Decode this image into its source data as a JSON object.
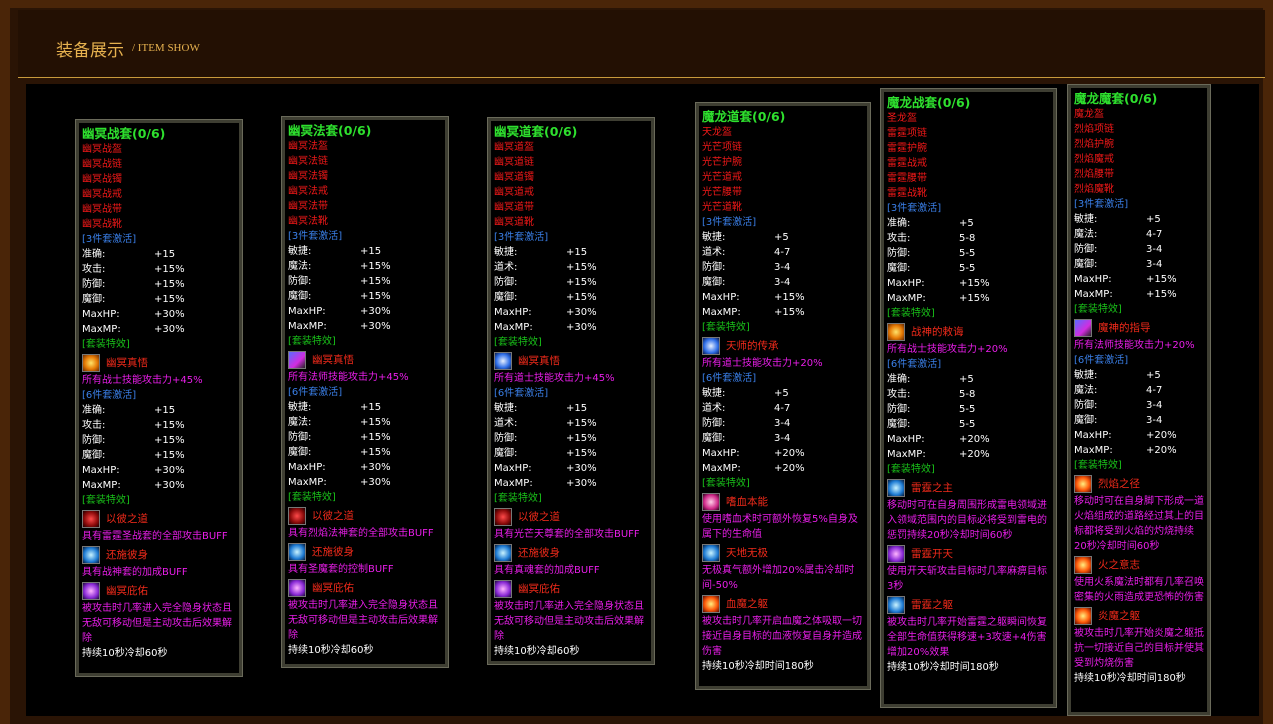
{
  "header": {
    "title_cn": "装备展示",
    "title_en": "/ ITEM SHOW"
  },
  "sets": [
    {
      "name": "幽冥战套(0/6)",
      "pieces": [
        "幽冥战盔",
        "幽冥战链",
        "幽冥战镯",
        "幽冥战戒",
        "幽冥战带",
        "幽冥战靴"
      ],
      "set3_label": "[3件套激活]",
      "set3_stats": [
        [
          "准确:",
          "+15"
        ],
        [
          "攻击:",
          "+15%"
        ],
        [
          "防御:",
          "+15%"
        ],
        [
          "魔御:",
          "+15%"
        ],
        [
          "MaxHP:",
          "+30%"
        ],
        [
          "MaxMP:",
          "+30%"
        ]
      ],
      "effect_label": "[套装特效]",
      "skill3": {
        "icon": "warrior-skill-icon",
        "name": "幽冥真悟",
        "desc": "所有战士技能攻击力+45%"
      },
      "set6_label": "[6件套激活]",
      "set6_stats": [
        [
          "准确:",
          "+15"
        ],
        [
          "攻击:",
          "+15%"
        ],
        [
          "防御:",
          "+15%"
        ],
        [
          "魔御:",
          "+15%"
        ],
        [
          "MaxHP:",
          "+30%"
        ],
        [
          "MaxMP:",
          "+30%"
        ]
      ],
      "effect6_label": "[套装特效]",
      "skills6": [
        {
          "icon": "dark-skill-icon",
          "name": "以彼之道",
          "desc": "具有雷霆圣战套的全部攻击BUFF"
        },
        {
          "icon": "blue-skill-icon",
          "name": "还施彼身",
          "desc": "具有战神套的加成BUFF"
        },
        {
          "icon": "purple-skill-icon",
          "name": "幽冥庇佑",
          "desc": "被攻击时几率进入完全隐身状态且无敌可移动但是主动攻击后效果解除"
        }
      ],
      "duration": "持续10秒冷却60秒"
    },
    {
      "name": "幽冥法套(0/6)",
      "pieces": [
        "幽冥法盔",
        "幽冥法链",
        "幽冥法镯",
        "幽冥法戒",
        "幽冥法带",
        "幽冥法靴"
      ],
      "set3_label": "[3件套激活]",
      "set3_stats": [
        [
          "敏捷:",
          "+15"
        ],
        [
          "魔法:",
          "+15%"
        ],
        [
          "防御:",
          "+15%"
        ],
        [
          "魔御:",
          "+15%"
        ],
        [
          "MaxHP:",
          "+30%"
        ],
        [
          "MaxMP:",
          "+30%"
        ]
      ],
      "effect_label": "[套装特效]",
      "skill3": {
        "icon": "mage-skill-icon",
        "name": "幽冥真悟",
        "desc": "所有法师技能攻击力+45%"
      },
      "set6_label": "[6件套激活]",
      "set6_stats": [
        [
          "敏捷:",
          "+15"
        ],
        [
          "魔法:",
          "+15%"
        ],
        [
          "防御:",
          "+15%"
        ],
        [
          "魔御:",
          "+15%"
        ],
        [
          "MaxHP:",
          "+30%"
        ],
        [
          "MaxMP:",
          "+30%"
        ]
      ],
      "effect6_label": "[套装特效]",
      "skills6": [
        {
          "icon": "dark-skill-icon",
          "name": "以彼之道",
          "desc": "具有烈焰法神套的全部攻击BUFF"
        },
        {
          "icon": "blue-skill-icon",
          "name": "还施彼身",
          "desc": "具有圣魔套的控制BUFF"
        },
        {
          "icon": "purple-skill-icon",
          "name": "幽冥庇佑",
          "desc": "被攻击时几率进入完全隐身状态且无敌可移动但是主动攻击后效果解除"
        }
      ],
      "duration": "持续10秒冷却60秒"
    },
    {
      "name": "幽冥道套(0/6)",
      "pieces": [
        "幽冥道盔",
        "幽冥道链",
        "幽冥道镯",
        "幽冥道戒",
        "幽冥道带",
        "幽冥道靴"
      ],
      "set3_label": "[3件套激活]",
      "set3_stats": [
        [
          "敏捷:",
          "+15"
        ],
        [
          "道术:",
          "+15%"
        ],
        [
          "防御:",
          "+15%"
        ],
        [
          "魔御:",
          "+15%"
        ],
        [
          "MaxHP:",
          "+30%"
        ],
        [
          "MaxMP:",
          "+30%"
        ]
      ],
      "effect_label": "[套装特效]",
      "skill3": {
        "icon": "taoist-skill-icon",
        "name": "幽冥真悟",
        "desc": "所有道士技能攻击力+45%"
      },
      "set6_label": "[6件套激活]",
      "set6_stats": [
        [
          "敏捷:",
          "+15"
        ],
        [
          "道术:",
          "+15%"
        ],
        [
          "防御:",
          "+15%"
        ],
        [
          "魔御:",
          "+15%"
        ],
        [
          "MaxHP:",
          "+30%"
        ],
        [
          "MaxMP:",
          "+30%"
        ]
      ],
      "effect6_label": "[套装特效]",
      "skills6": [
        {
          "icon": "dark-skill-icon",
          "name": "以彼之道",
          "desc": "具有光芒天尊套的全部攻击BUFF"
        },
        {
          "icon": "blue-skill-icon",
          "name": "还施彼身",
          "desc": "具有真魂套的加成BUFF"
        },
        {
          "icon": "purple-skill-icon",
          "name": "幽冥庇佑",
          "desc": "被攻击时几率进入完全隐身状态且无敌可移动但是主动攻击后效果解除"
        }
      ],
      "duration": "持续10秒冷却60秒"
    },
    {
      "name": "魔龙道套(0/6)",
      "pieces": [
        "天龙盔",
        "光芒项链",
        "光芒护腕",
        "光芒道戒",
        "光芒腰带",
        "光芒道靴"
      ],
      "set3_label": "[3件套激活]",
      "set3_stats": [
        [
          "敏捷:",
          "+5"
        ],
        [
          "道术:",
          "4-7"
        ],
        [
          "防御:",
          "3-4"
        ],
        [
          "魔御:",
          "3-4"
        ],
        [
          "MaxHP:",
          "+15%"
        ],
        [
          "MaxMP:",
          "+15%"
        ]
      ],
      "effect_label": "[套装特效]",
      "skill3": {
        "icon": "taoist-skill-icon",
        "name": "天师的传承",
        "desc": "所有道士技能攻击力+20%"
      },
      "set6_label": "[6件套激活]",
      "set6_stats": [
        [
          "敏捷:",
          "+5"
        ],
        [
          "道术:",
          "4-7"
        ],
        [
          "防御:",
          "3-4"
        ],
        [
          "魔御:",
          "3-4"
        ],
        [
          "MaxHP:",
          "+20%"
        ],
        [
          "MaxMP:",
          "+20%"
        ]
      ],
      "effect6_label": "[套装特效]",
      "skills6": [
        {
          "icon": "pink-skill-icon",
          "name": "嗜血本能",
          "desc": "使用嗜血术时可额外恢复5%自身及属下的生命值"
        },
        {
          "icon": "blue-skill-icon",
          "name": "天地无极",
          "desc": "无极真气额外增加20%属击冷却时间-50%"
        },
        {
          "icon": "fire-skill-icon",
          "name": "血魔之躯",
          "desc": "被攻击时几率开启血魔之体吸取一切接近自身目标的血液恢复自身并造成伤害"
        }
      ],
      "duration": "持续10秒冷却时间180秒"
    },
    {
      "name": "魔龙战套(0/6)",
      "pieces": [
        "圣龙盔",
        "雷霆项链",
        "雷霆护腕",
        "雷霆战戒",
        "雷霆腰带",
        "雷霆战靴"
      ],
      "set3_label": "[3件套激活]",
      "set3_stats": [
        [
          "准确:",
          "+5"
        ],
        [
          "攻击:",
          "5-8"
        ],
        [
          "防御:",
          "5-5"
        ],
        [
          "魔御:",
          "5-5"
        ],
        [
          "MaxHP:",
          "+15%"
        ],
        [
          "MaxMP:",
          "+15%"
        ]
      ],
      "effect_label": "[套装特效]",
      "skill3": {
        "icon": "warrior-skill-icon",
        "name": "战神的敕诲",
        "desc": "所有战士技能攻击力+20%"
      },
      "set6_label": "[6件套激活]",
      "set6_stats": [
        [
          "准确:",
          "+5"
        ],
        [
          "攻击:",
          "5-8"
        ],
        [
          "防御:",
          "5-5"
        ],
        [
          "魔御:",
          "5-5"
        ],
        [
          "MaxHP:",
          "+20%"
        ],
        [
          "MaxMP:",
          "+20%"
        ]
      ],
      "effect6_label": "[套装特效]",
      "skills6": [
        {
          "icon": "blue-skill-icon",
          "name": "雷霆之主",
          "desc": "移动时可在自身周围形成雷电领域进入领域范围内的目标必将受到雷电的惩罚持续20秒冷却时间60秒"
        },
        {
          "icon": "purple-skill-icon",
          "name": "雷霆开天",
          "desc": "使用开天斩攻击目标时几率麻痹目标3秒"
        },
        {
          "icon": "blue-skill-icon",
          "name": "雷霆之躯",
          "desc": "被攻击时几率开始雷霆之躯瞬间恢复全部生命值获得移速+3攻速+4伤害增加20%效果"
        }
      ],
      "duration": "持续10秒冷却时间180秒"
    },
    {
      "name": "魔龙魔套(0/6)",
      "pieces": [
        "魔龙盔",
        "烈焰项链",
        "烈焰护腕",
        "烈焰魔戒",
        "烈焰腰带",
        "烈焰魔靴"
      ],
      "set3_label": "[3件套激活]",
      "set3_stats": [
        [
          "敏捷:",
          "+5"
        ],
        [
          "魔法:",
          "4-7"
        ],
        [
          "防御:",
          "3-4"
        ],
        [
          "魔御:",
          "3-4"
        ],
        [
          "MaxHP:",
          "+15%"
        ],
        [
          "MaxMP:",
          "+15%"
        ]
      ],
      "effect_label": "[套装特效]",
      "skill3": {
        "icon": "mage-skill-icon",
        "name": "魔神的指导",
        "desc": "所有法师技能攻击力+20%"
      },
      "set6_label": "[6件套激活]",
      "set6_stats": [
        [
          "敏捷:",
          "+5"
        ],
        [
          "魔法:",
          "4-7"
        ],
        [
          "防御:",
          "3-4"
        ],
        [
          "魔御:",
          "3-4"
        ],
        [
          "MaxHP:",
          "+20%"
        ],
        [
          "MaxMP:",
          "+20%"
        ]
      ],
      "effect6_label": "[套装特效]",
      "skills6": [
        {
          "icon": "fire-skill-icon",
          "name": "烈焰之径",
          "desc": "移动时可在自身脚下形成一道火焰组成的道路经过其上的目标都将受到火焰的灼烧持续20秒冷却时间60秒"
        },
        {
          "icon": "fire-skill-icon",
          "name": "火之意志",
          "desc": "使用火系魔法时都有几率召唤密集的火雨造成更恐怖的伤害"
        },
        {
          "icon": "fire-skill-icon",
          "name": "炎魔之躯",
          "desc": "被攻击时几率开始炎魔之躯抵抗一切接近自己的目标并使其受到灼烧伤害"
        }
      ],
      "duration": "持续10秒冷却时间180秒"
    }
  ]
}
